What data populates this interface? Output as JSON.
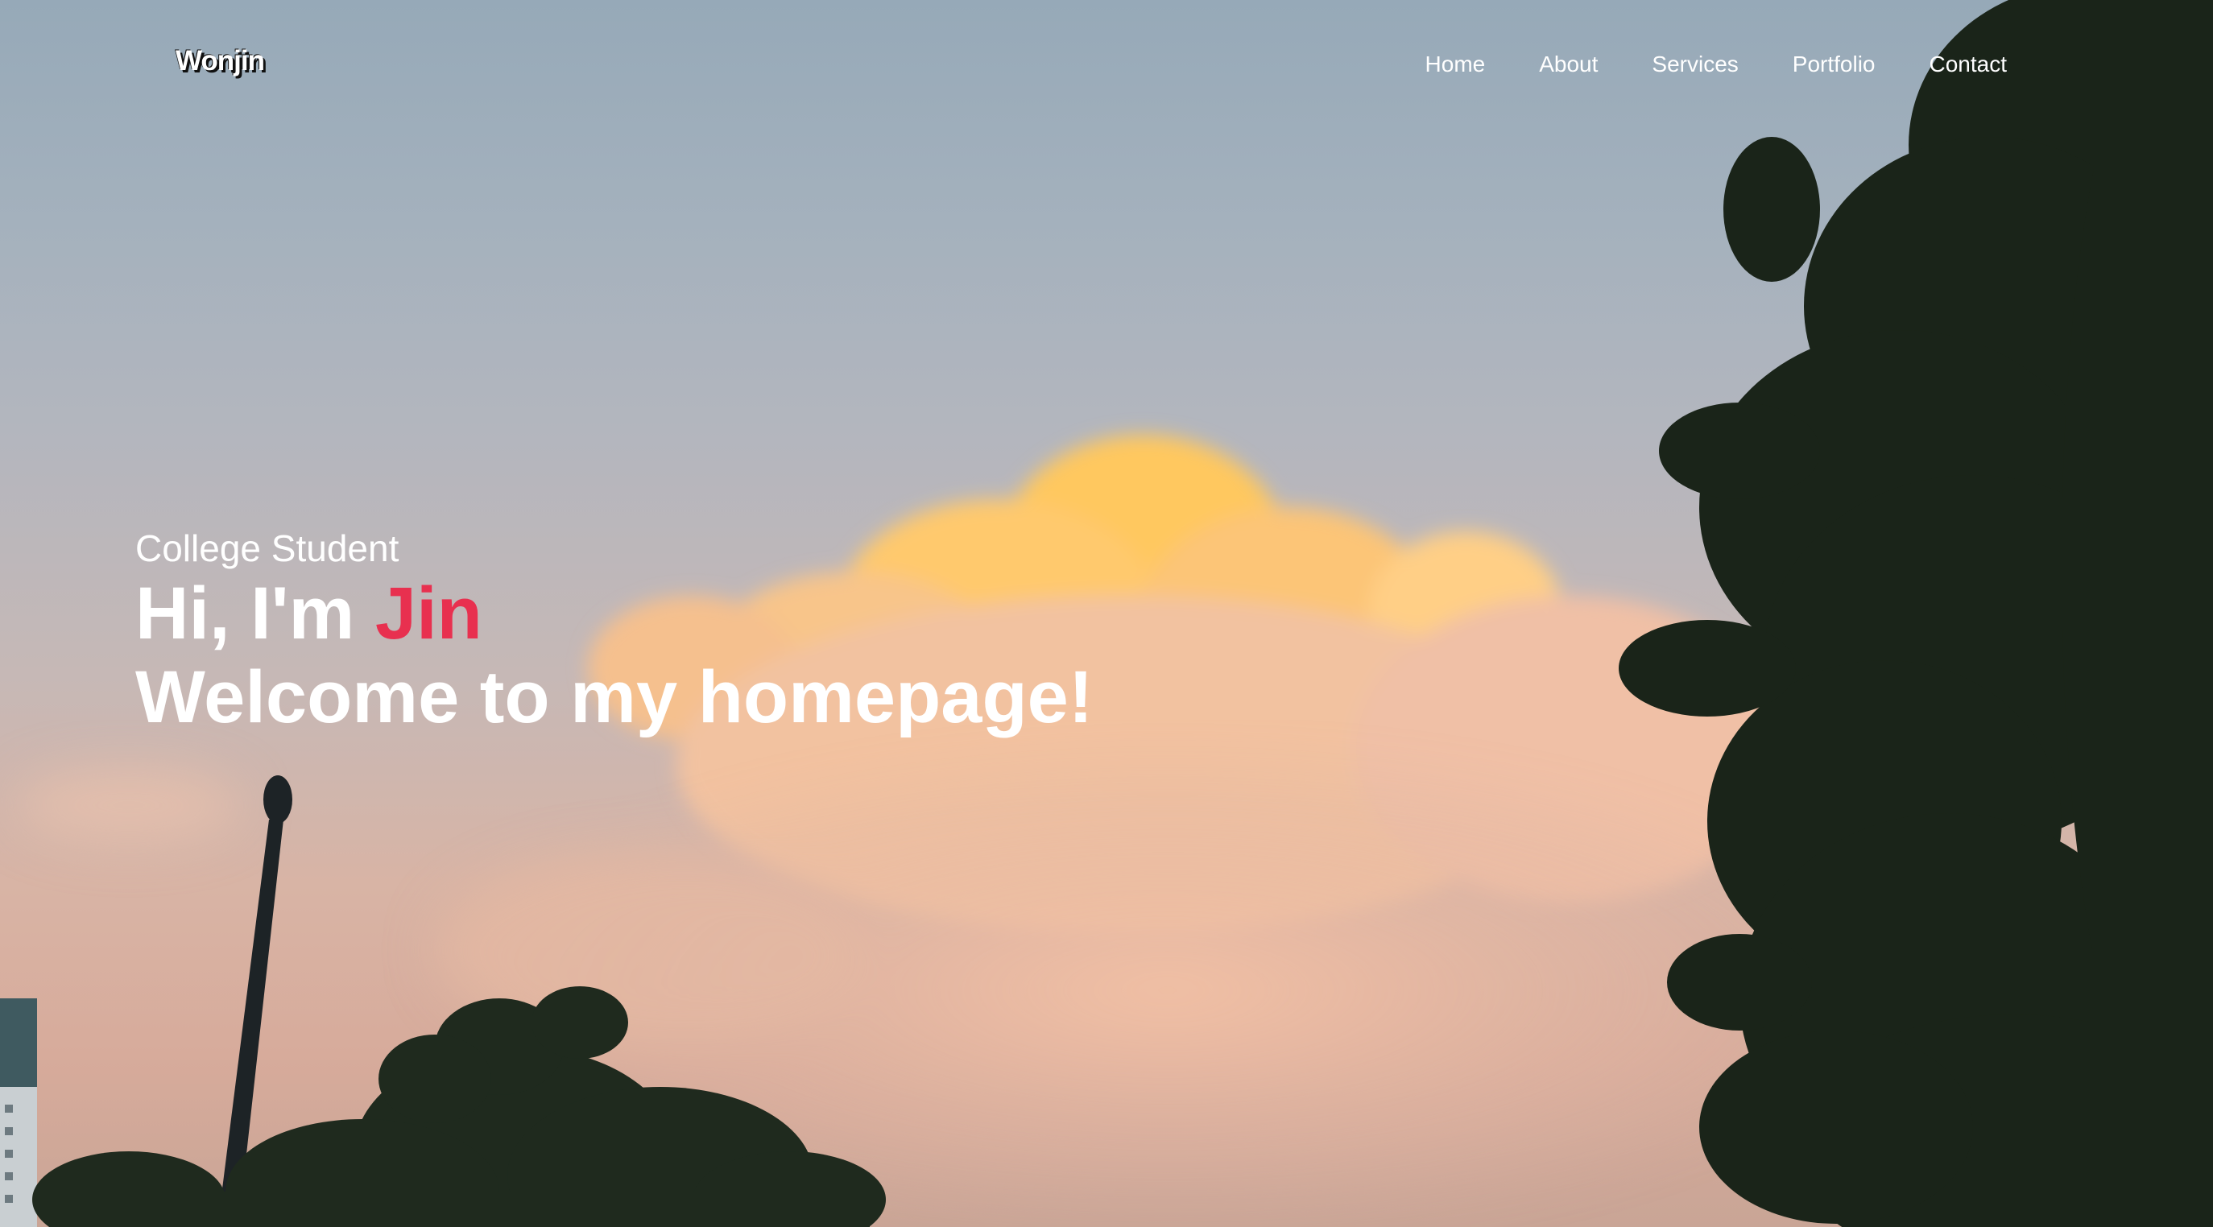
{
  "header": {
    "logo": "Wonjin",
    "nav": [
      {
        "label": "Home"
      },
      {
        "label": "About"
      },
      {
        "label": "Services"
      },
      {
        "label": "Portfolio"
      },
      {
        "label": "Contact"
      }
    ]
  },
  "hero": {
    "subtitle": "College Student",
    "greeting_prefix": "Hi, I'm ",
    "name": "Jin",
    "welcome": "Welcome to my homepage!"
  },
  "colors": {
    "accent": "#e8304f",
    "text": "#ffffff"
  }
}
